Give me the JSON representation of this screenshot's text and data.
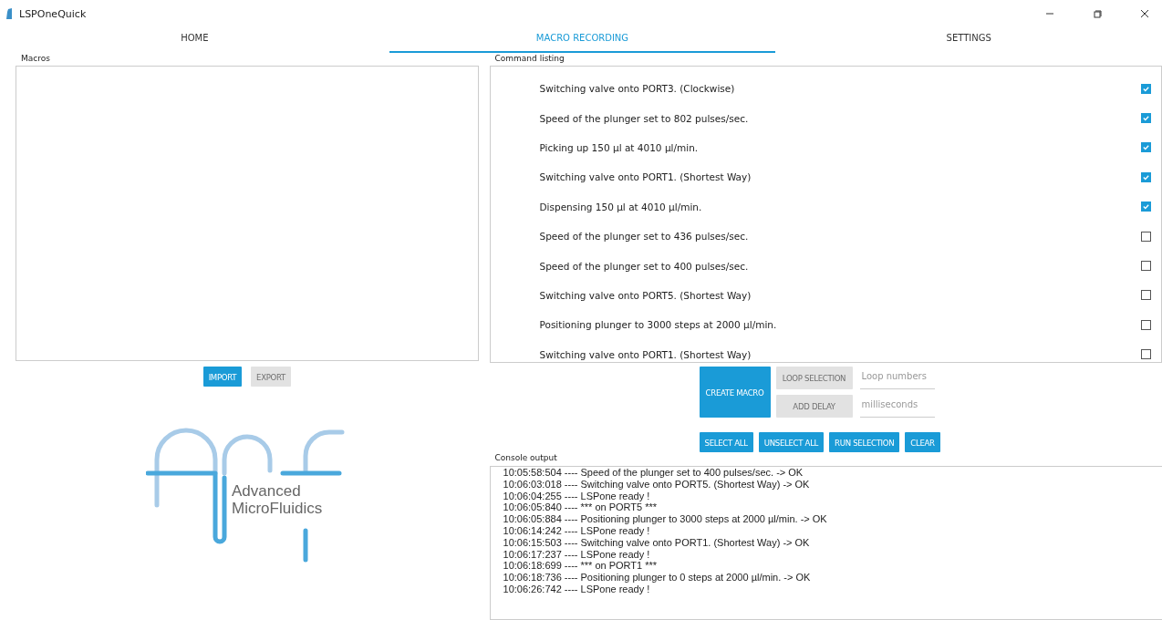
{
  "window": {
    "title": "LSPOneQuick"
  },
  "tabs": [
    {
      "label": "HOME",
      "selected": false
    },
    {
      "label": "MACRO RECORDING",
      "selected": true
    },
    {
      "label": "SETTINGS",
      "selected": false
    }
  ],
  "macros": {
    "label": "Macros",
    "buttons": [
      {
        "label": "IMPORT",
        "disabled": false
      },
      {
        "label": "EXPORT",
        "disabled": true
      }
    ]
  },
  "logo": {
    "line1": "Advanced",
    "line2": "MicroFluidics"
  },
  "commands": {
    "label": "Command listing",
    "items": [
      {
        "text": "Switching valve onto PORT3. (Clockwise)",
        "checked": true
      },
      {
        "text": "Speed of the plunger set to 802 pulses/sec.",
        "checked": true
      },
      {
        "text": "Picking up 150 µl at 4010 µl/min.",
        "checked": true
      },
      {
        "text": "Switching valve onto PORT1. (Shortest Way)",
        "checked": true
      },
      {
        "text": "Dispensing 150 µl at 4010 µl/min.",
        "checked": true
      },
      {
        "text": "Speed of the plunger set to 436 pulses/sec.",
        "checked": false
      },
      {
        "text": "Speed of the plunger set to 400 pulses/sec.",
        "checked": false
      },
      {
        "text": "Switching valve onto PORT5. (Shortest Way)",
        "checked": false
      },
      {
        "text": "Positioning plunger to 3000 steps at 2000 µl/min.",
        "checked": false
      },
      {
        "text": "Switching valve onto PORT1. (Shortest Way)",
        "checked": false
      }
    ]
  },
  "create_macro": {
    "label": "CREATE MACRO"
  },
  "loop_selection": {
    "label": "LOOP SELECTION",
    "disabled": true,
    "placeholder": "Loop numbers"
  },
  "add_delay": {
    "label": "ADD DELAY",
    "disabled": true,
    "placeholder": "milliseconds"
  },
  "actions": [
    {
      "label": "SELECT ALL"
    },
    {
      "label": "UNSELECT ALL"
    },
    {
      "label": "RUN SELECTION"
    },
    {
      "label": "CLEAR"
    }
  ],
  "console": {
    "label": "Console output",
    "lines": [
      "10:05:58:504 ---- Speed of the plunger set to 400 pulses/sec. -> OK",
      "10:06:03:018 ---- Switching valve onto PORT5. (Shortest Way) -> OK",
      "10:06:04:255 ---- LSPone ready !",
      "10:06:05:840 ---- *** on PORT5 ***",
      "10:06:05:884 ---- Positioning plunger to 3000 steps at 2000 µl/min. -> OK",
      "10:06:14:242 ---- LSPone ready !",
      "10:06:15:503 ---- Switching valve onto PORT1. (Shortest Way) -> OK",
      "10:06:17:237 ---- LSPone ready !",
      "10:06:18:699 ---- *** on PORT1 ***",
      "10:06:18:736 ---- Positioning plunger to 0 steps at 2000 µl/min. -> OK",
      "10:06:26:742 ---- LSPone ready !"
    ]
  }
}
